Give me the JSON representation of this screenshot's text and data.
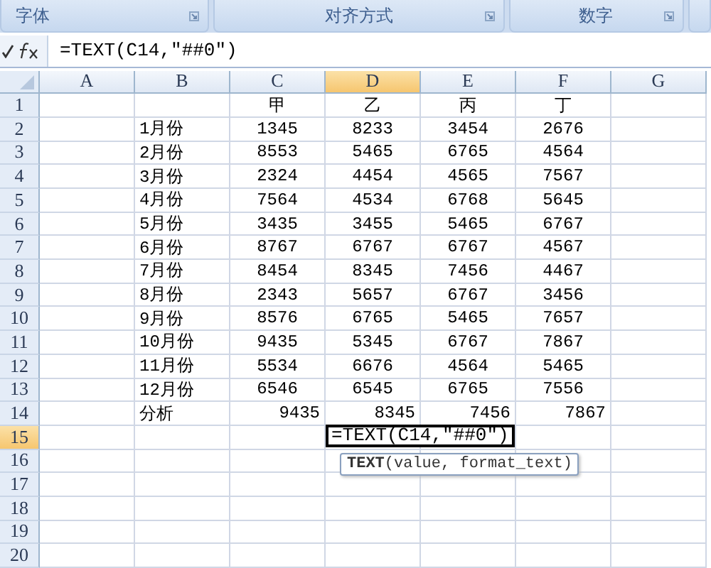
{
  "ribbon": {
    "groups": [
      {
        "label": "字体"
      },
      {
        "label": "对齐方式"
      },
      {
        "label": "数字"
      }
    ]
  },
  "formula_bar": {
    "formula": "=TEXT(C14,″##0″)"
  },
  "sheet": {
    "columns": [
      {
        "label": "A",
        "selected": false
      },
      {
        "label": "B",
        "selected": false
      },
      {
        "label": "C",
        "selected": false
      },
      {
        "label": "D",
        "selected": true
      },
      {
        "label": "E",
        "selected": false
      },
      {
        "label": "F",
        "selected": false
      },
      {
        "label": "G",
        "selected": false
      }
    ],
    "rows": [
      {
        "label": "1",
        "selected": false,
        "kind": "header",
        "cells": {
          "C": "甲",
          "D": "乙",
          "E": "丙",
          "F": "丁"
        }
      },
      {
        "label": "2",
        "selected": false,
        "kind": "data",
        "cells": {
          "B": "1月份",
          "C": "1345",
          "D": "8233",
          "E": "3454",
          "F": "2676"
        }
      },
      {
        "label": "3",
        "selected": false,
        "kind": "data",
        "cells": {
          "B": "2月份",
          "C": "8553",
          "D": "5465",
          "E": "6765",
          "F": "4564"
        }
      },
      {
        "label": "4",
        "selected": false,
        "kind": "data",
        "cells": {
          "B": "3月份",
          "C": "2324",
          "D": "4454",
          "E": "4565",
          "F": "7567"
        }
      },
      {
        "label": "5",
        "selected": false,
        "kind": "data",
        "cells": {
          "B": "4月份",
          "C": "7564",
          "D": "4534",
          "E": "6768",
          "F": "5645"
        }
      },
      {
        "label": "6",
        "selected": false,
        "kind": "data",
        "cells": {
          "B": "5月份",
          "C": "3435",
          "D": "3455",
          "E": "5465",
          "F": "6767"
        }
      },
      {
        "label": "7",
        "selected": false,
        "kind": "data",
        "cells": {
          "B": "6月份",
          "C": "8767",
          "D": "6767",
          "E": "6767",
          "F": "4567"
        }
      },
      {
        "label": "8",
        "selected": false,
        "kind": "data",
        "cells": {
          "B": "7月份",
          "C": "8454",
          "D": "8345",
          "E": "7456",
          "F": "4467"
        }
      },
      {
        "label": "9",
        "selected": false,
        "kind": "data",
        "cells": {
          "B": "8月份",
          "C": "2343",
          "D": "5657",
          "E": "6767",
          "F": "3456"
        }
      },
      {
        "label": "10",
        "selected": false,
        "kind": "data",
        "cells": {
          "B": "9月份",
          "C": "8576",
          "D": "6765",
          "E": "5465",
          "F": "7657"
        }
      },
      {
        "label": "11",
        "selected": false,
        "kind": "data",
        "cells": {
          "B": "10月份",
          "C": "9435",
          "D": "5345",
          "E": "6767",
          "F": "7867"
        }
      },
      {
        "label": "12",
        "selected": false,
        "kind": "data",
        "cells": {
          "B": "11月份",
          "C": "5534",
          "D": "6676",
          "E": "4564",
          "F": "5465"
        }
      },
      {
        "label": "13",
        "selected": false,
        "kind": "data",
        "cells": {
          "B": "12月份",
          "C": "6546",
          "D": "6545",
          "E": "6765",
          "F": "7556"
        }
      },
      {
        "label": "14",
        "selected": false,
        "kind": "total",
        "cells": {
          "B": "分析",
          "C": "9435",
          "D": "8345",
          "E": "7456",
          "F": "7867"
        }
      },
      {
        "label": "15",
        "selected": true,
        "kind": "empty",
        "editing": {
          "D": {
            "value": "=TEXT(C14,″##0″)",
            "tooltip": "**TEXT**(value, format_text)"
          }
        }
      },
      {
        "label": "16",
        "selected": false,
        "kind": "empty"
      },
      {
        "label": "17",
        "selected": false,
        "kind": "empty"
      },
      {
        "label": "18",
        "selected": false,
        "kind": "empty"
      },
      {
        "label": "19",
        "selected": false,
        "kind": "empty"
      },
      {
        "label": "20",
        "selected": false,
        "kind": "empty"
      }
    ]
  }
}
